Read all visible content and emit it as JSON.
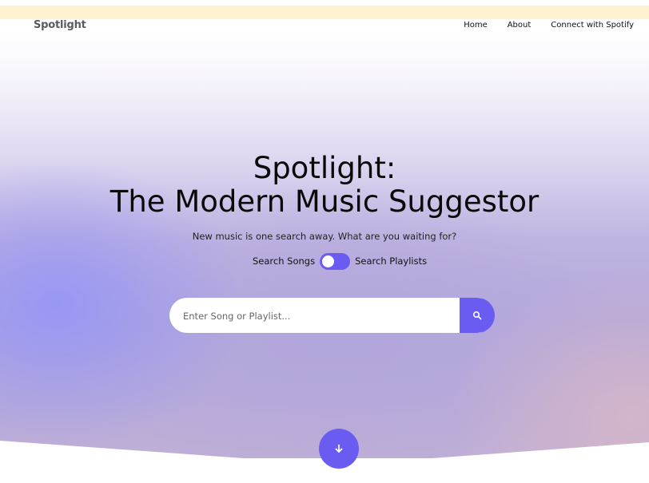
{
  "nav": {
    "brand": "Spotlight",
    "links": [
      {
        "label": "Home"
      },
      {
        "label": "About"
      },
      {
        "label": "Connect with Spotify"
      }
    ]
  },
  "hero": {
    "title_line1": "Spotlight:",
    "title_line2": "The Modern Music Suggestor",
    "subtitle": "New music is one search away. What are you waiting for?",
    "toggle": {
      "left_label": "Search Songs",
      "right_label": "Search Playlists"
    },
    "search": {
      "value": "",
      "placeholder": "Enter Song or Playlist..."
    }
  },
  "icons": {
    "search_button": "search-icon",
    "scroll_button": "arrow-down-icon"
  },
  "colors": {
    "accent": "#6a5cf0",
    "top_strip": "#fdf3cf",
    "brand_text": "#5a5a5a"
  }
}
